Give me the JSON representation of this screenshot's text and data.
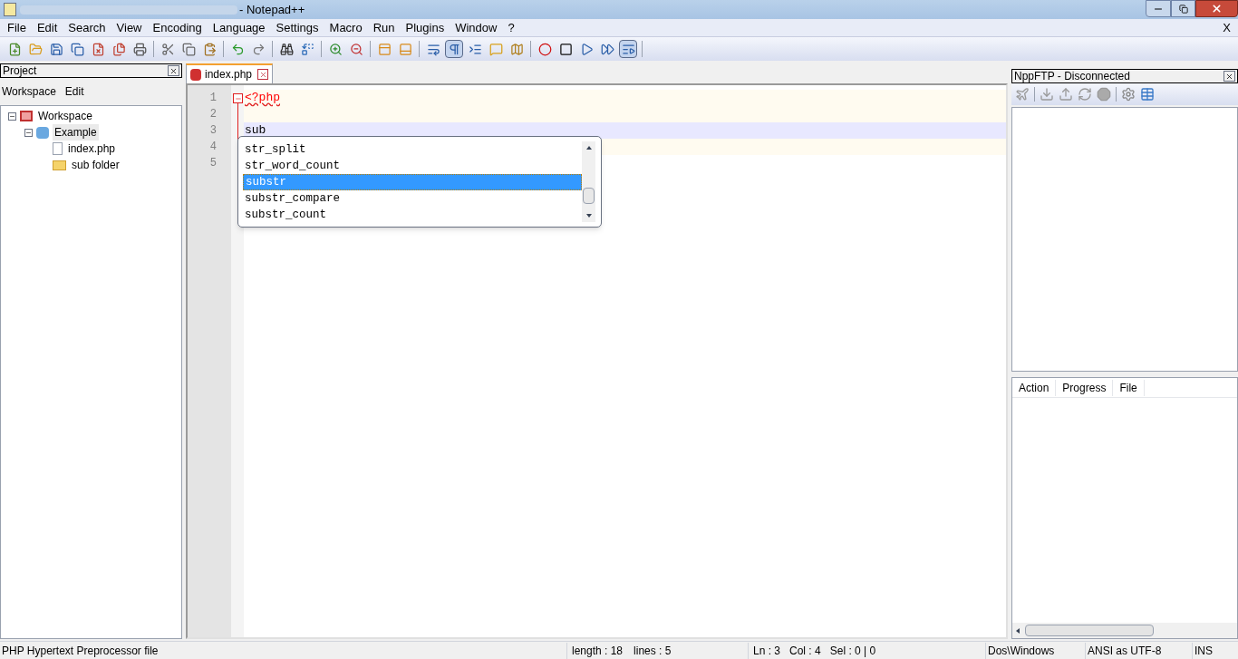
{
  "window": {
    "title": "- Notepad++"
  },
  "menu": [
    "File",
    "Edit",
    "Search",
    "View",
    "Encoding",
    "Language",
    "Settings",
    "Macro",
    "Run",
    "Plugins",
    "Window",
    "?"
  ],
  "menu_close": "X",
  "toolbar": [
    {
      "pressed": false
    },
    {
      "pressed": false
    },
    {
      "pressed": false
    },
    {
      "pressed": false
    },
    {
      "pressed": false
    },
    {
      "pressed": false
    },
    {
      "pressed": false
    },
    {
      "pressed": false
    },
    {
      "pressed": false
    },
    {
      "pressed": false
    },
    {
      "pressed": false
    },
    {
      "pressed": false
    },
    {
      "pressed": false
    },
    {
      "pressed": false
    },
    {
      "pressed": false
    },
    {
      "pressed": false
    },
    {
      "pressed": false
    },
    {
      "pressed": false
    },
    {
      "pressed": false
    },
    {
      "pressed": true
    },
    {
      "pressed": false
    },
    {
      "pressed": false
    },
    {
      "pressed": false
    },
    {
      "pressed": false
    },
    {
      "pressed": false
    },
    {
      "pressed": false
    },
    {
      "pressed": false
    },
    {
      "pressed": true
    }
  ],
  "project_panel": {
    "title": "Project",
    "menu": [
      "Workspace",
      "Edit"
    ],
    "tree": [
      {
        "label": "Workspace",
        "kind": "workspace",
        "expanded": true,
        "selected": false,
        "children": [
          {
            "label": "Example",
            "kind": "project",
            "expanded": true,
            "selected": true,
            "children": [
              {
                "label": "index.php",
                "kind": "file",
                "selected": false
              },
              {
                "label": "sub folder",
                "kind": "folder",
                "selected": false
              }
            ]
          }
        ]
      }
    ]
  },
  "tabs": [
    {
      "label": "index.php",
      "selected": true
    }
  ],
  "editor": {
    "lines": [
      {
        "number": "1",
        "text": "<?php",
        "kind": "php",
        "current": false,
        "block": true
      },
      {
        "number": "2",
        "current": false,
        "block": true
      },
      {
        "number": "3",
        "text": "sub",
        "kind": "plain",
        "current": true,
        "block": true
      },
      {
        "number": "4",
        "current": false,
        "block": true
      },
      {
        "number": "5",
        "current": false,
        "block": false
      }
    ],
    "autocomplete": [
      {
        "label": "str_split",
        "selected": false
      },
      {
        "label": "str_word_count",
        "selected": false
      },
      {
        "label": "substr",
        "selected": true
      },
      {
        "label": "substr_compare",
        "selected": false
      },
      {
        "label": "substr_count",
        "selected": false
      }
    ]
  },
  "ftp_panel": {
    "title": "NppFTP - Disconnected",
    "columns": [
      "Action",
      "Progress",
      "File"
    ]
  },
  "status_bar": {
    "file_type": "PHP Hypertext Preprocessor file",
    "length": "length : 18",
    "lines": "lines : 5",
    "ln": "Ln : 3",
    "col": "Col : 4",
    "sel": "Sel : 0 | 0",
    "eol": "Dos\\Windows",
    "encoding": "ANSI as UTF-8",
    "mode": "INS"
  }
}
